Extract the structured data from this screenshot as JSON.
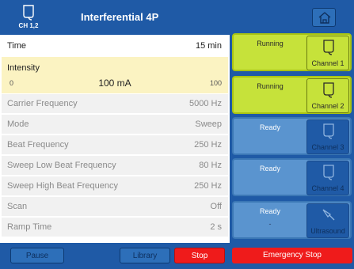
{
  "header": {
    "channel_label": "CH 1,2",
    "title": "Interferential 4P"
  },
  "time": {
    "label": "Time",
    "value": "15 min"
  },
  "intensity": {
    "label": "Intensity",
    "min": "0",
    "current": "100 mA",
    "max": "100"
  },
  "params": [
    {
      "label": "Carrier Frequency",
      "value": "5000 Hz"
    },
    {
      "label": "Mode",
      "value": "Sweep"
    },
    {
      "label": "Beat Frequency",
      "value": "250 Hz"
    },
    {
      "label": "Sweep Low Beat Frequency",
      "value": "80 Hz"
    },
    {
      "label": "Sweep High Beat Frequency",
      "value": "250 Hz"
    },
    {
      "label": "Scan",
      "value": "Off"
    },
    {
      "label": "Ramp Time",
      "value": "2 s"
    }
  ],
  "buttons": {
    "pause": "Pause",
    "library": "Library",
    "stop": "Stop",
    "emergency_stop": "Emergency Stop"
  },
  "channels": [
    {
      "status": "Running",
      "name": "Channel 1",
      "sub": ""
    },
    {
      "status": "Running",
      "name": "Channel 2",
      "sub": ""
    },
    {
      "status": "Ready",
      "name": "Channel 3",
      "sub": ""
    },
    {
      "status": "Ready",
      "name": "Channel 4",
      "sub": ""
    },
    {
      "status": "Ready",
      "name": "Ultrasound",
      "sub": "-"
    }
  ],
  "colors": {
    "header_blue": "#1f5aa6",
    "running_green": "#c6e23a",
    "ready_blue": "#5a94cf",
    "stop_red": "#ef1b1b",
    "intensity_highlight": "#fbf3c2"
  },
  "icons": {
    "channel": "electrode-pad-icon",
    "home": "home-icon",
    "ultrasound": "ultrasound-probe-icon"
  }
}
